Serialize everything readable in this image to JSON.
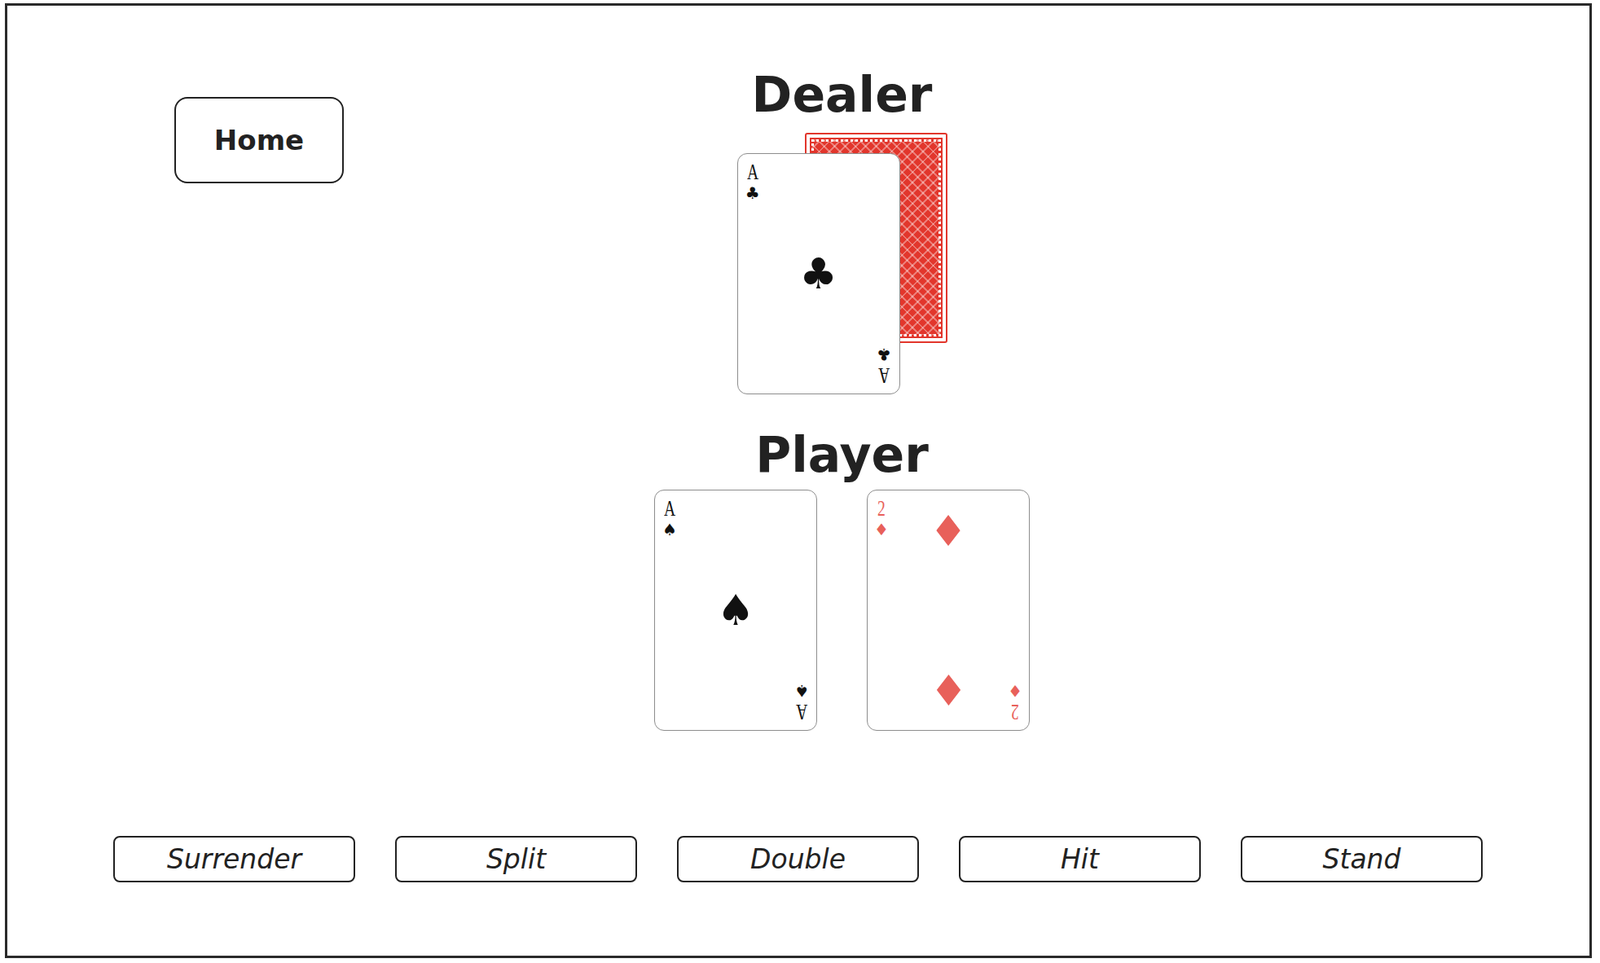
{
  "home_button": {
    "label": "Home"
  },
  "dealer": {
    "title": "Dealer",
    "cards": [
      {
        "kind": "back"
      },
      {
        "kind": "face",
        "rank": "A",
        "suit": "♣",
        "color": "#111111"
      }
    ]
  },
  "player": {
    "title": "Player",
    "cards": [
      {
        "kind": "face",
        "rank": "A",
        "suit": "♠",
        "color": "#111111"
      },
      {
        "kind": "face",
        "rank": "2",
        "suit": "♦",
        "color": "#e8605a"
      }
    ]
  },
  "actions": [
    "Surrender",
    "Split",
    "Double",
    "Hit",
    "Stand"
  ]
}
